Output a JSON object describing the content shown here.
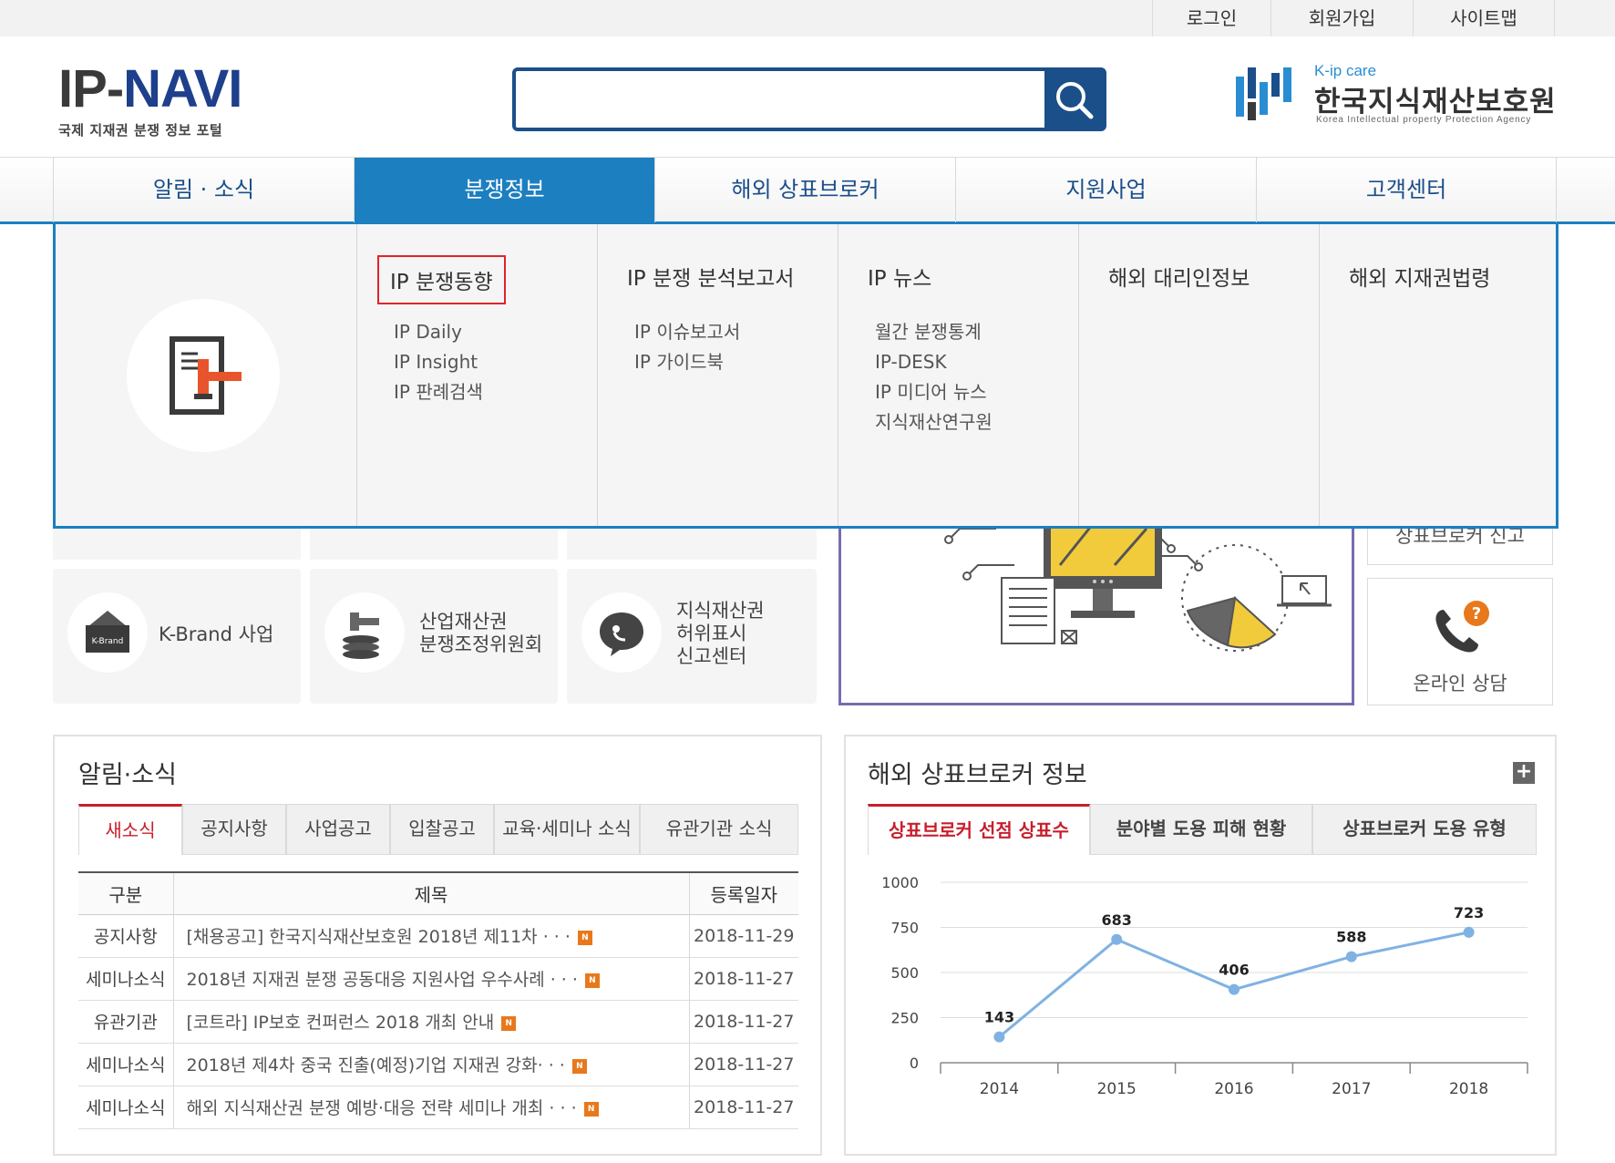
{
  "util_nav": {
    "login": "로그인",
    "join": "회원가입",
    "sitemap": "사이트맵"
  },
  "logo": {
    "brand_ip": "IP",
    "brand_navi": "NAVI",
    "tagline": "국제 지재권 분쟁 정보 포털"
  },
  "search": {
    "placeholder": "",
    "value": ""
  },
  "org": {
    "care": "K-ip care",
    "name": "한국지식재산보호원",
    "name_en": "Korea Intellectual property Protection Agency"
  },
  "gnb": {
    "items": [
      {
        "label": "알림 · 소식"
      },
      {
        "label": "분쟁정보"
      },
      {
        "label": "해외 상표브로커"
      },
      {
        "label": "지원사업"
      },
      {
        "label": "고객센터"
      }
    ]
  },
  "mega": {
    "columns": [
      {
        "title": "IP 분쟁동향",
        "links": [
          "IP Daily",
          "IP Insight",
          "IP 판례검색"
        ]
      },
      {
        "title": "IP 분쟁 분석보고서",
        "links": [
          "IP 이슈보고서",
          "IP 가이드북"
        ]
      },
      {
        "title": "IP 뉴스",
        "links": [
          "월간 분쟁통계",
          "IP-DESK",
          "IP 미디어 뉴스",
          "지식재산연구원"
        ]
      },
      {
        "title": "해외 대리인정보",
        "links": []
      },
      {
        "title": "해외 지재권법령",
        "links": []
      }
    ]
  },
  "quick": {
    "kbrand": "K-Brand 사업",
    "kbrand_icon_text": "K-Brand",
    "mediation_l1": "산업재산권",
    "mediation_l2": "분쟁조정위원회",
    "false_l1": "지식재산권",
    "false_l2": "허위표시",
    "false_l3": "신고센터"
  },
  "side": {
    "report": "상표브로커 신고",
    "consult": "온라인 상담"
  },
  "news": {
    "title": "알림·소식",
    "tabs": [
      "새소식",
      "공지사항",
      "사업공고",
      "입찰공고",
      "교육·세미나 소식",
      "유관기관 소식"
    ],
    "headers": {
      "cat": "구분",
      "title": "제목",
      "date": "등록일자"
    },
    "rows": [
      {
        "cat": "공지사항",
        "title": "[채용공고] 한국지식재산보호원 2018년 제11차 · · ·",
        "date": "2018-11-29"
      },
      {
        "cat": "세미나소식",
        "title": "2018년 지재권 분쟁 공동대응 지원사업 우수사례 · · ·",
        "date": "2018-11-27"
      },
      {
        "cat": "유관기관",
        "title": "[코트라] IP보호 컨퍼런스 2018 개최 안내",
        "date": "2018-11-27"
      },
      {
        "cat": "세미나소식",
        "title": "2018년 제4차 중국 진출(예정)기업 지재권 강화· · ·",
        "date": "2018-11-27"
      },
      {
        "cat": "세미나소식",
        "title": "해외 지식재산권 분쟁 예방·대응 전략 세미나 개최 · · ·",
        "date": "2018-11-27"
      }
    ],
    "new_badge": "N"
  },
  "broker": {
    "title": "해외 상표브로커 정보",
    "plus": "+",
    "tabs": [
      "상표브로커 선점 상표수",
      "분야별 도용 피해 현황",
      "상표브로커 도용 유형"
    ]
  },
  "chart_data": {
    "type": "line",
    "categories": [
      "2014",
      "2015",
      "2016",
      "2017",
      "2018"
    ],
    "values": [
      143,
      683,
      406,
      588,
      723
    ],
    "title": "",
    "xlabel": "",
    "ylabel": "",
    "ylim": [
      0,
      1000
    ],
    "yticks": [
      0,
      250,
      500,
      750,
      1000
    ],
    "line_color": "#7fb2e3",
    "grid": true,
    "data_labels": true
  },
  "colors": {
    "accent": "#1c7fc0",
    "brand_dark": "#1b4f8a",
    "alert_red": "#c81e2c",
    "new_badge": "#e8781c"
  }
}
